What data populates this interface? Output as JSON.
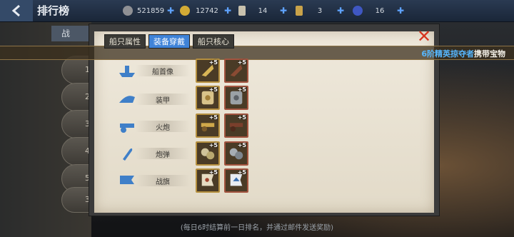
{
  "header": {
    "back_icon": "back-arrow-icon",
    "title": "排行榜"
  },
  "resources": [
    {
      "icon": "silver-coin-icon",
      "value": "521859",
      "color": "#9b9b9b"
    },
    {
      "icon": "gold-coin-icon",
      "value": "12742",
      "color": "#d8b13a"
    },
    {
      "icon": "scroll-icon",
      "value": "14",
      "color": "#c8c1ad"
    },
    {
      "icon": "ticket-icon",
      "value": "3",
      "color": "#c9a34a"
    },
    {
      "icon": "gem-icon",
      "value": "16",
      "color": "#4a63c9"
    }
  ],
  "rank_panel": {
    "tab_label": "战",
    "rows": [
      "1",
      "2",
      "3",
      "4",
      "5",
      "3"
    ]
  },
  "announcement": {
    "highlight": "6阶精英掠夺者",
    "text": "携带宝物"
  },
  "modal": {
    "tabs": [
      {
        "label": "船只属性",
        "active": false
      },
      {
        "label": "装备穿戴",
        "active": true
      },
      {
        "label": "船只核心",
        "active": false
      }
    ],
    "close_icon": "close-x-icon",
    "equipment": [
      {
        "label": "船首像",
        "icon": "ship-figurehead-icon",
        "slots": [
          {
            "level": "+5",
            "art": "figurehead-gold"
          },
          {
            "level": "+5",
            "art": "figurehead-bronze"
          }
        ]
      },
      {
        "label": "装甲",
        "icon": "armor-plating-icon",
        "slots": [
          {
            "level": "+5",
            "art": "armor-gold"
          },
          {
            "level": "+5",
            "art": "armor-steel"
          }
        ]
      },
      {
        "label": "火炮",
        "icon": "cannon-icon",
        "slots": [
          {
            "level": "+5",
            "art": "cannon-gold"
          },
          {
            "level": "+5",
            "art": "cannon-bronze"
          }
        ]
      },
      {
        "label": "炮弹",
        "icon": "shell-icon",
        "slots": [
          {
            "level": "+5",
            "art": "cannonball-gold"
          },
          {
            "level": "+5",
            "art": "cannonball-steel"
          }
        ]
      },
      {
        "label": "战旗",
        "icon": "war-flag-icon",
        "slots": [
          {
            "level": "+5",
            "art": "flag-gold"
          },
          {
            "level": "+5",
            "art": "flag-blue"
          }
        ]
      }
    ]
  },
  "footer": {
    "text": "(每日6时结算前一日排名，并通过邮件发送奖励)"
  }
}
